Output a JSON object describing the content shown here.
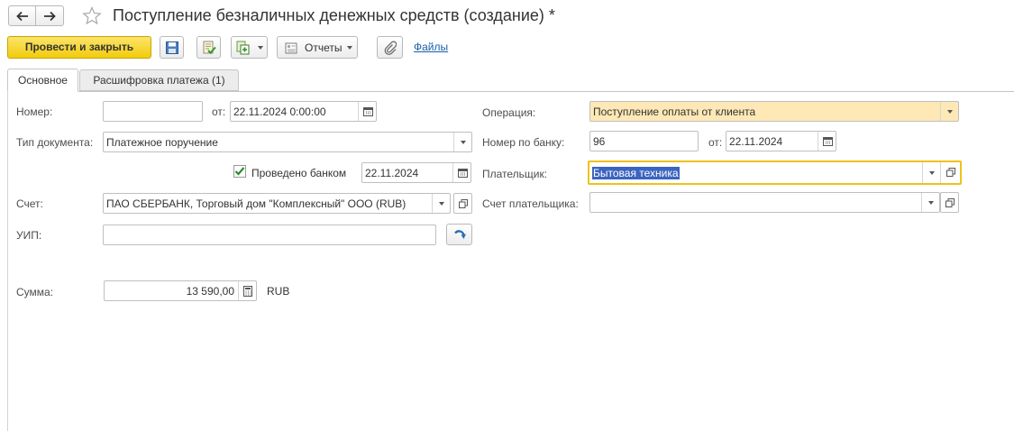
{
  "window": {
    "title": "Поступление безналичных денежных средств (создание) *"
  },
  "toolbar": {
    "post_close_label": "Провести и закрыть",
    "reports_label": "Отчеты",
    "files_label": "Файлы"
  },
  "tabs": [
    {
      "label": "Основное",
      "active": true
    },
    {
      "label": "Расшифровка платежа (1)",
      "active": false
    }
  ],
  "form": {
    "number": {
      "label": "Номер:",
      "value": ""
    },
    "date_from": {
      "label": "от:",
      "value": "22.11.2024  0:00:00"
    },
    "doc_type": {
      "label": "Тип документа:",
      "value": "Платежное поручение"
    },
    "bank_posted": {
      "label": "Проведено банком",
      "checked": true,
      "date": "22.11.2024"
    },
    "account": {
      "label": "Счет:",
      "value": "ПАО СБЕРБАНК, Торговый дом \"Комплексный\" ООО (RUB)"
    },
    "uip": {
      "label": "УИП:",
      "value": ""
    },
    "amount": {
      "label": "Сумма:",
      "value": "13 590,00",
      "currency": "RUB"
    },
    "operation": {
      "label": "Операция:",
      "value": "Поступление оплаты от клиента"
    },
    "bank_number": {
      "label": "Номер по банку:",
      "value": "96",
      "date_label": "от:",
      "date": "22.11.2024"
    },
    "payer": {
      "label": "Плательщик:",
      "value": "Бытовая техника"
    },
    "payer_account": {
      "label": "Счет плательщика:",
      "value": ""
    }
  },
  "colors": {
    "primary_button": "#f2cc0c",
    "operation_field": "#fde8b6",
    "focus_border": "#f0c21a",
    "selection": "#3b64c0",
    "link": "#1b5fa8"
  }
}
